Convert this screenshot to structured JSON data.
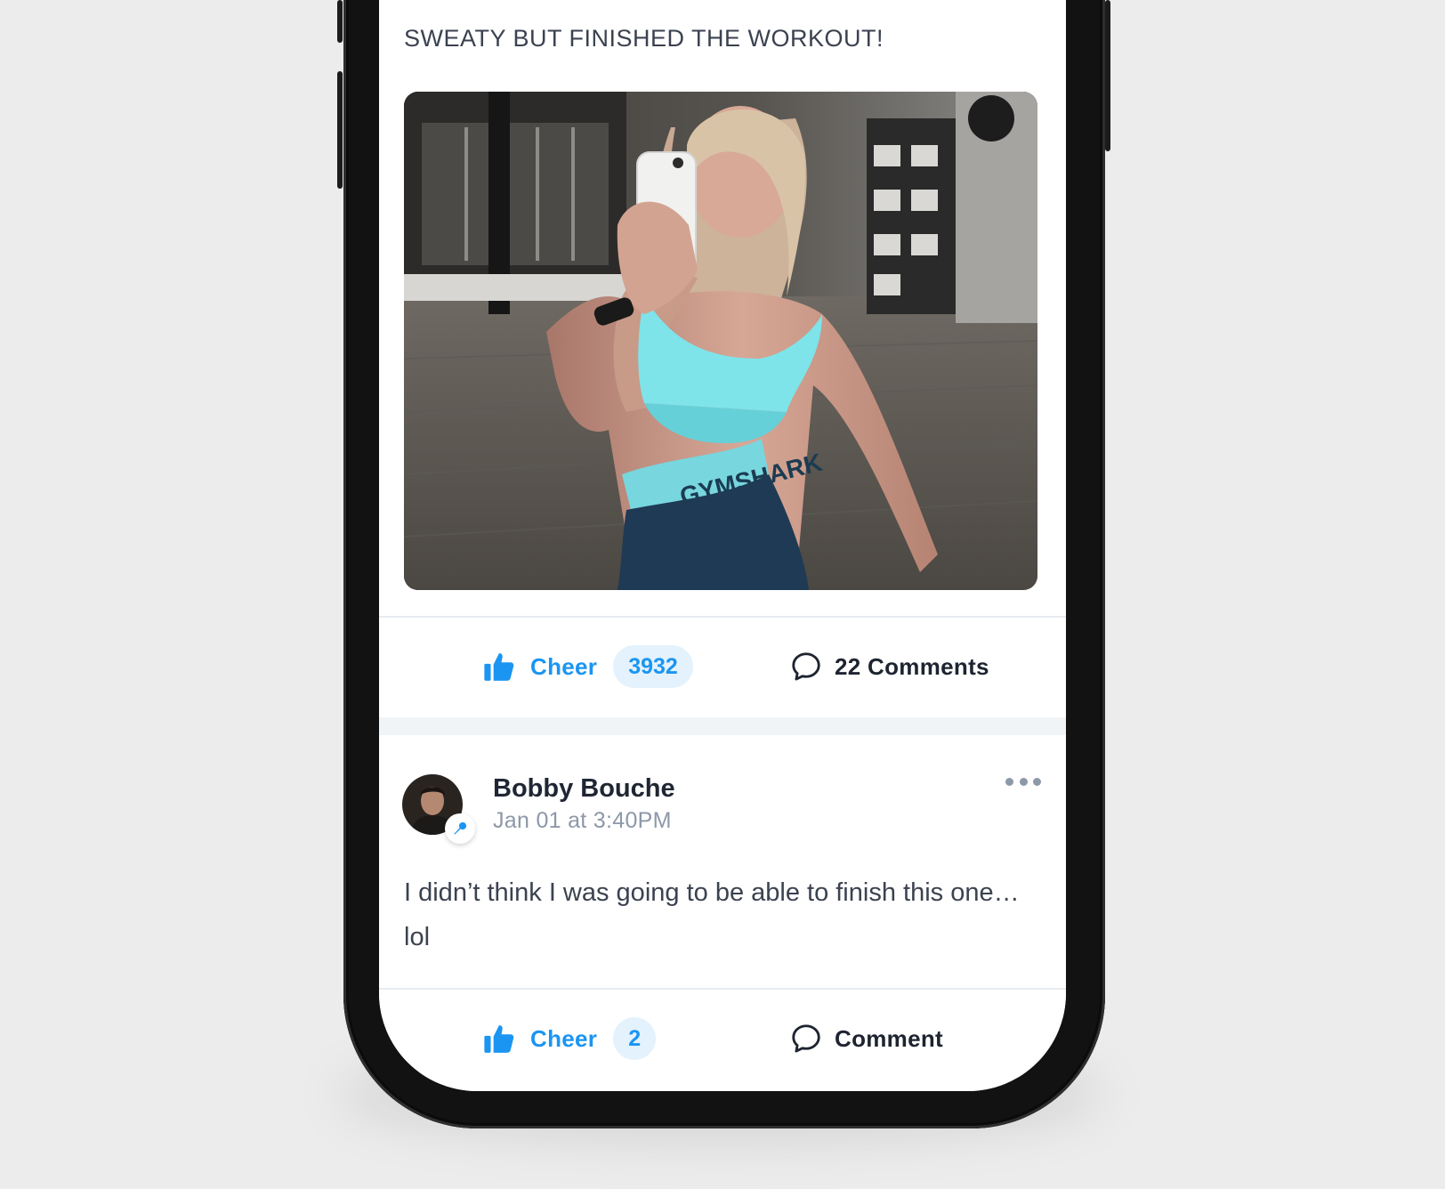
{
  "posts": [
    {
      "caption": "SWEATY BUT FINISHED THE WORKOUT!",
      "photo_subject": "gym mirror selfie",
      "photo_waistband_text": "GYMSHARK",
      "cheer_label": "Cheer",
      "cheer_count": "3932",
      "comment_label": "22 Comments"
    },
    {
      "author": "Bobby Bouche",
      "timestamp": "Jan 01 at 3:40PM",
      "body": "I didn’t think I was going to be able to finish this one… lol",
      "cheer_label": "Cheer",
      "cheer_count": "2",
      "comment_label": "Comment"
    }
  ],
  "icons": {
    "cheer": "thumbs-up-icon",
    "comment": "speech-bubble-icon",
    "more": "ellipsis-icon",
    "avatar_badge": "microphone-icon"
  },
  "colors": {
    "accent": "#1b95f2",
    "accent_soft": "#e3f2fd",
    "text_primary": "#1f2633",
    "text_secondary": "#8d98a8",
    "feed_background": "#f1f4f7"
  }
}
